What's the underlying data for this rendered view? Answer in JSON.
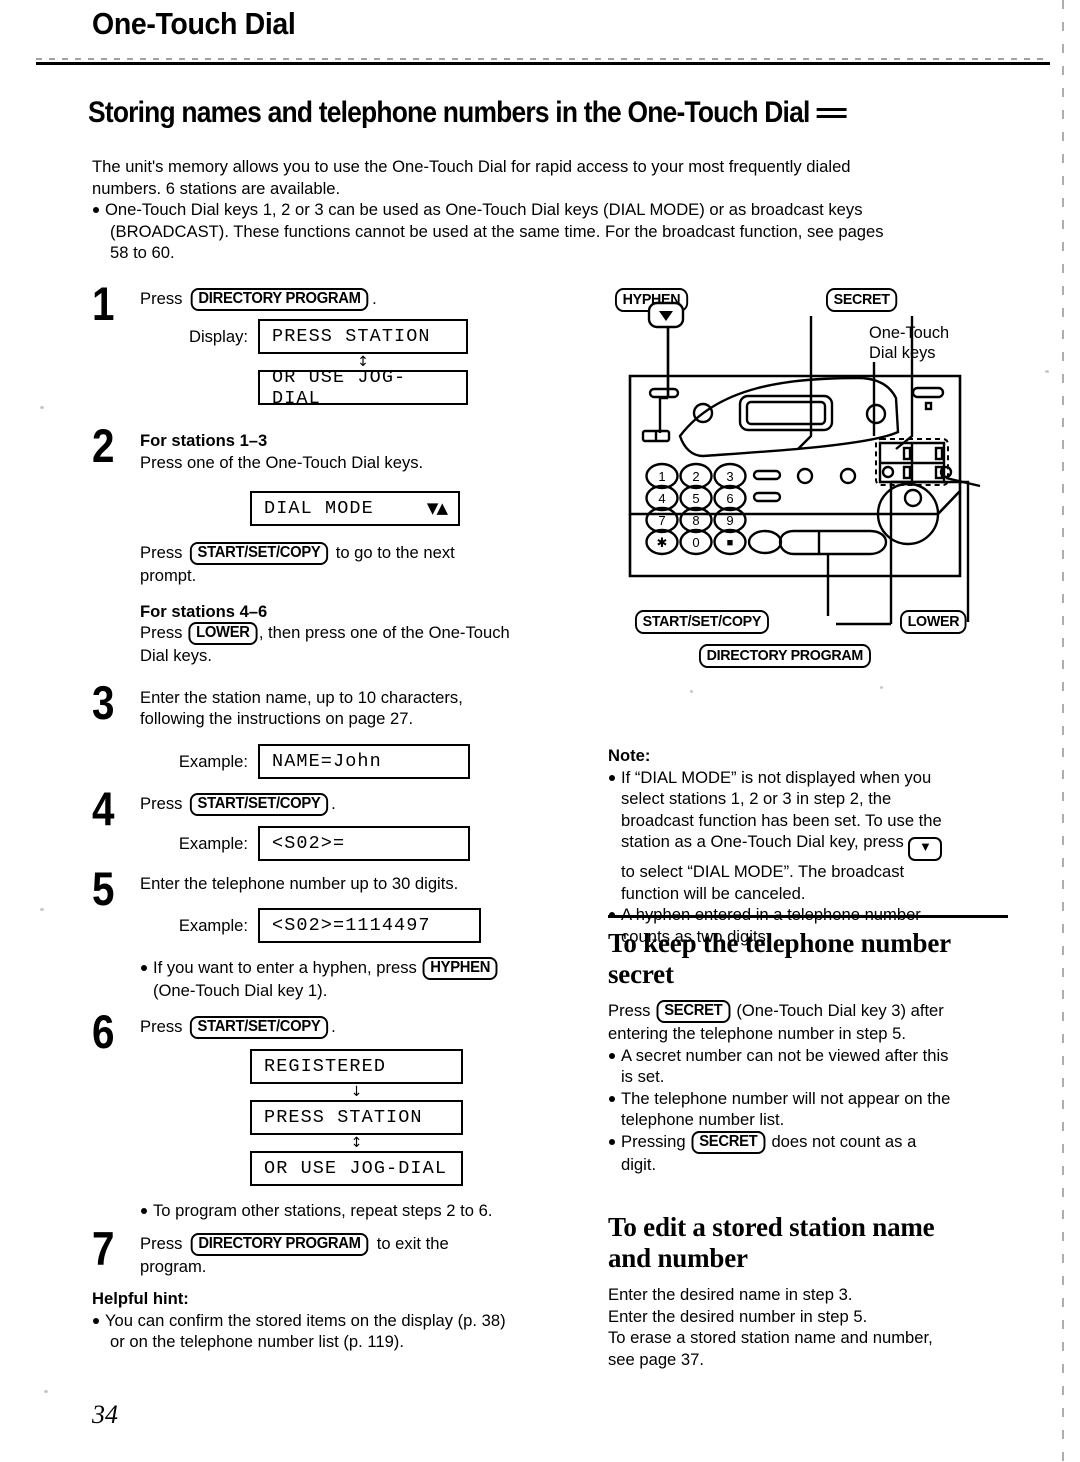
{
  "header": {
    "chapter_title": "One-Touch Dial",
    "section_title": "Storing names and telephone numbers in the One-Touch Dial"
  },
  "intro": {
    "para1_line1": "The unit's memory allows you to use the One-Touch Dial for rapid access to your most frequently dialed",
    "para1_line2": "numbers. 6 stations are available.",
    "bullet1_line1": "One-Touch Dial keys 1, 2 or 3 can be used as One-Touch Dial keys (DIAL MODE) or as broadcast keys",
    "bullet1_line2": "(BROADCAST). These functions cannot be used at the same time. For the broadcast function, see pages",
    "bullet1_line3": "58 to 60."
  },
  "steps": {
    "s1": {
      "num": "1",
      "text_before": "Press",
      "key": "DIRECTORY PROGRAM",
      "text_after": ".",
      "display_label": "Display:",
      "lcd1": "PRESS STATION",
      "lcd2": "OR USE JOG-DIAL"
    },
    "s2": {
      "num": "2",
      "heading_a": "For stations 1–3",
      "text_a": "Press one of the One-Touch Dial keys.",
      "lcd1": "DIAL MODE",
      "lcd1_right": "▼▲",
      "text_b_before": "Press",
      "key_b": "START/SET/COPY",
      "text_b_after": "to go to the next",
      "text_b_line2": "prompt.",
      "heading_b": "For stations 4–6",
      "text_c_before": "Press",
      "key_c": "LOWER",
      "text_c_after": ", then press one of the One-Touch",
      "text_c_line2": "Dial keys."
    },
    "s3": {
      "num": "3",
      "line1": "Enter the station name, up to 10 characters,",
      "line2": "following the instructions on page 27.",
      "example_label": "Example:",
      "lcd1": "NAME=John"
    },
    "s4": {
      "num": "4",
      "text_before": "Press",
      "key": "START/SET/COPY",
      "text_after": ".",
      "example_label": "Example:",
      "lcd1": "<S02>="
    },
    "s5": {
      "num": "5",
      "line1": "Enter the telephone number up to 30 digits.",
      "example_label": "Example:",
      "lcd1": "<S02>=1114497",
      "bullet_before": "If you want to enter a hyphen, press",
      "bullet_key": "HYPHEN",
      "bullet_line2": "(One-Touch Dial key 1)."
    },
    "s6": {
      "num": "6",
      "text_before": "Press",
      "key": "START/SET/COPY",
      "text_after": ".",
      "lcd1": "REGISTERED",
      "lcd2": "PRESS STATION",
      "lcd3": "OR USE JOG-DIAL",
      "bullet": "To program other stations, repeat steps 2 to 6."
    },
    "s7": {
      "num": "7",
      "text_before": "Press",
      "key": "DIRECTORY PROGRAM",
      "text_after": "to exit the",
      "line2": "program."
    }
  },
  "helpful_hint": {
    "heading": "Helpful hint:",
    "bullet_line1": "You can confirm the stored items on the display (p. 38)",
    "bullet_line2": "or on the telephone number list (p. 119)."
  },
  "device": {
    "label_hyphen": "HYPHEN",
    "label_secret": "SECRET",
    "label_start": "START/SET/COPY",
    "label_lower": "LOWER",
    "label_directory": "DIRECTORY PROGRAM",
    "callout_line1": "One-Touch",
    "callout_line2": "Dial keys",
    "keypad": [
      "1",
      "2",
      "3",
      "4",
      "5",
      "6",
      "7",
      "8",
      "9",
      "✱",
      "0",
      "■"
    ]
  },
  "note": {
    "heading": "Note:",
    "b1_l1": "If “DIAL MODE” is not displayed when you",
    "b1_l2": "select stations 1, 2 or 3 in step 2, the",
    "b1_l3": "broadcast function has been set. To use the",
    "b1_l4_before": "station as a One-Touch Dial key, press",
    "b1_l5": "to select “DIAL MODE”. The broadcast",
    "b1_l6": "function will be canceled.",
    "b2_l1": "A hyphen entered in a telephone number",
    "b2_l2": "counts as two digits."
  },
  "secret_section": {
    "heading_line1": "To keep the telephone number",
    "heading_line2": "secret",
    "p1_before": "Press",
    "p1_key": "SECRET",
    "p1_after": "(One-Touch Dial key 3) after",
    "p1_line2": "entering the telephone number in step 5.",
    "b1_l1": "A secret number can not be viewed after this",
    "b1_l2": "is set.",
    "b2_l1": "The telephone number will not appear on the",
    "b2_l2": "telephone number list.",
    "b3_before": "Pressing",
    "b3_key": "SECRET",
    "b3_after": "does not count as a",
    "b3_l2": "digit."
  },
  "edit_section": {
    "heading_line1": "To edit a stored station name",
    "heading_line2": "and number",
    "line1": "Enter the desired name in step 3.",
    "line2": "Enter the desired number in step 5.",
    "line3": "To erase a stored station name and number,",
    "line4": "see page 37."
  },
  "footer": {
    "page_number": "34"
  }
}
